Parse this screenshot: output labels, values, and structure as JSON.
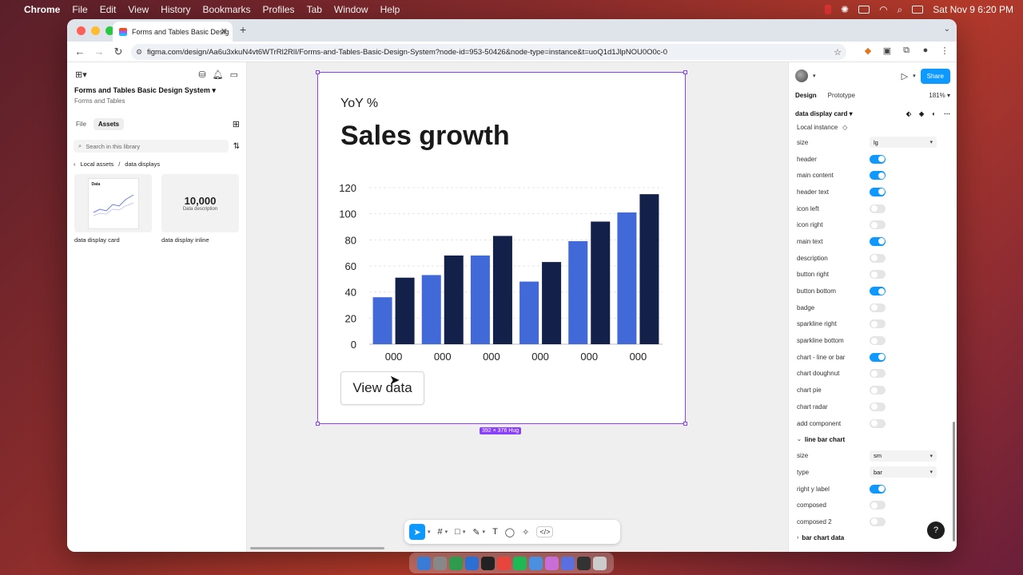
{
  "menubar": {
    "app": "Chrome",
    "items": [
      "File",
      "Edit",
      "View",
      "History",
      "Bookmarks",
      "Profiles",
      "Tab",
      "Window",
      "Help"
    ],
    "datetime": "Sat Nov 9  6:20 PM"
  },
  "browser": {
    "tab_title": "Forms and Tables Basic Desig",
    "url": "figma.com/design/Aa6u3xkuN4vt6WTrRl2RlI/Forms-and-Tables-Basic-Design-System?node-id=953-50426&node-type=instance&t=uoQ1d1JlpNOU0O0c-0"
  },
  "left_panel": {
    "project_title": "Forms and Tables Basic Design System",
    "project_subtitle": "Forms and Tables",
    "tabs": [
      "File",
      "Assets"
    ],
    "search_placeholder": "Search in this library",
    "breadcrumb": [
      "Local assets",
      "data displays"
    ],
    "assets": [
      {
        "label": "data display card",
        "mini_title": "Data"
      },
      {
        "label": "data display inline",
        "big_value": "10,000",
        "big_desc": "Data description"
      }
    ]
  },
  "card": {
    "eyebrow": "YoY %",
    "title": "Sales growth",
    "button": "View data",
    "size_badge": "392 × 376 Hug"
  },
  "chart_data": {
    "type": "bar",
    "categories": [
      "000",
      "000",
      "000",
      "000",
      "000",
      "000"
    ],
    "series": [
      {
        "color": "#4169d8",
        "values": [
          36,
          53,
          68,
          48,
          79,
          101
        ]
      },
      {
        "color": "#13204a",
        "values": [
          51,
          68,
          83,
          63,
          94,
          115
        ]
      }
    ],
    "ylim": [
      0,
      120
    ],
    "yticks": [
      0,
      20,
      40,
      60,
      80,
      100,
      120
    ],
    "grid": true
  },
  "right_panel": {
    "tabs": [
      "Design",
      "Prototype"
    ],
    "zoom": "181%",
    "share": "Share",
    "component_name": "data display card",
    "local_instance": "Local instance",
    "size_label": "size",
    "size_value": "lg",
    "props": [
      {
        "name": "header",
        "on": true
      },
      {
        "name": "main content",
        "on": true
      },
      {
        "name": "header text",
        "on": true
      },
      {
        "name": "icon left",
        "on": false
      },
      {
        "name": "icon right",
        "on": false
      },
      {
        "name": "main text",
        "on": true
      },
      {
        "name": "description",
        "on": false
      },
      {
        "name": "button right",
        "on": false
      },
      {
        "name": "button bottom",
        "on": true
      },
      {
        "name": "badge",
        "on": false
      },
      {
        "name": "sparkline right",
        "on": false
      },
      {
        "name": "sparkline bottom",
        "on": false
      },
      {
        "name": "chart - line or bar",
        "on": true
      },
      {
        "name": "chart doughnut",
        "on": false
      },
      {
        "name": "chart pie",
        "on": false
      },
      {
        "name": "chart radar",
        "on": false
      },
      {
        "name": "add component",
        "on": false
      }
    ],
    "section_line_bar": "line bar chart",
    "lb_size_label": "size",
    "lb_size_value": "sm",
    "lb_type_label": "type",
    "lb_type_value": "bar",
    "lb_props": [
      {
        "name": "right y label",
        "on": true
      },
      {
        "name": "composed",
        "on": false
      },
      {
        "name": "composed 2",
        "on": false
      }
    ],
    "section_bar_data": "bar chart data",
    "help": "?"
  }
}
